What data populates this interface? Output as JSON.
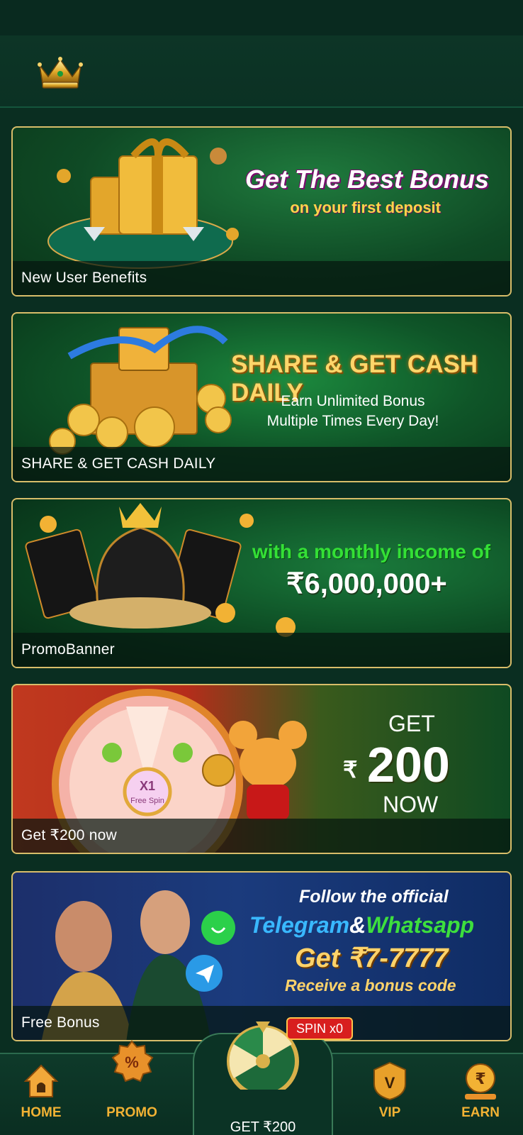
{
  "header": {
    "logo_icon": "crown-logo"
  },
  "banners": [
    {
      "caption": "New User Benefits",
      "headline": "Get The Best Bonus",
      "subline": "on your first deposit"
    },
    {
      "caption": "SHARE & GET CASH DAILY",
      "headline": "SHARE & GET CASH DAILY",
      "subline1": "Earn Unlimited Bonus",
      "subline2": "Multiple Times Every Day!"
    },
    {
      "caption": "PromoBanner",
      "line1": "with a monthly income of",
      "line2": "₹6,000,000+"
    },
    {
      "caption": "Get ₹200 now",
      "get": "GET",
      "rupee": "₹",
      "amount": "200",
      "now": "NOW",
      "wheel_center": "X1",
      "wheel_center_sub": "Free Spin"
    },
    {
      "caption": "Free Bonus",
      "line1": "Follow the official",
      "telegram": "Telegram",
      "amp": "&",
      "whatsapp": "Whatsapp",
      "line3": "Get ₹7-7777",
      "line4": "Receive a bonus code"
    }
  ],
  "spin_badge": "SPIN x0",
  "nav": {
    "home": "HOME",
    "promo": "PROMO",
    "center": "GET ₹200",
    "vip": "VIP",
    "earn": "EARN"
  },
  "colors": {
    "background": "#0a2e21",
    "gold": "#d8bd6a",
    "nav_label": "#f2b234"
  }
}
